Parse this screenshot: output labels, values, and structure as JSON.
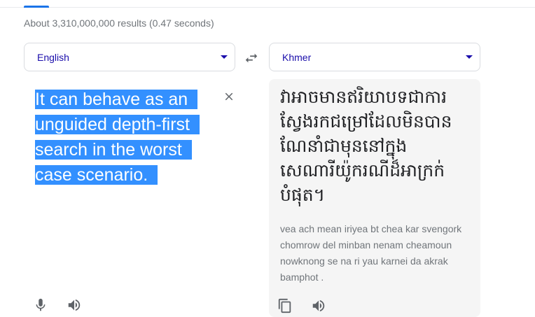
{
  "results_stats": "About 3,310,000,000 results (0.47 seconds)",
  "source_language": {
    "label": "English"
  },
  "target_language": {
    "label": "Khmer"
  },
  "source": {
    "text": "It can behave as an unguided depth-first search in the worst case scenario."
  },
  "target": {
    "text": "វាអាចមានឥរិយាបទជាការស្វែងរកជម្រៅដែលមិនបានណែនាំជាមុននៅក្នុងសេណារីយ៉ូករណីដ៏អាក្រក់បំផុត។",
    "transliteration": "vea ach mean iriyea bt chea kar svengork chomrow del minban nenam cheamoun nowknong se na ri yau karnei da akrak bamphot ."
  },
  "icons": {
    "swap": "swap-arrows-icon",
    "clear": "close-icon",
    "mic": "microphone-icon",
    "listen": "speaker-icon",
    "copy": "copy-icon",
    "dropdown": "caret-down-icon"
  },
  "colors": {
    "accent": "#1a73e8",
    "link": "#1a0dab",
    "selection": "#3390ff",
    "muted": "#70757a",
    "icon": "#5f6368"
  }
}
